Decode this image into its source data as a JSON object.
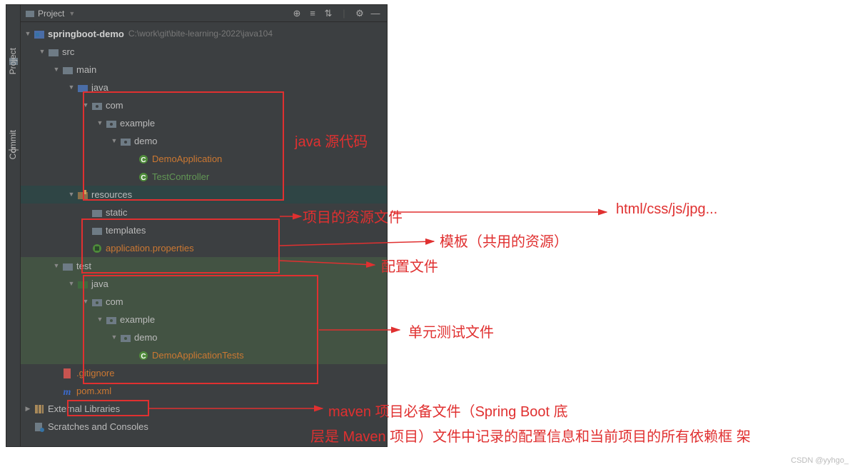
{
  "panel": {
    "title": "Project",
    "toolbar": {
      "target_icon": "⊕",
      "expand_icon": "≡",
      "options_icon": "⇅",
      "divider": "|",
      "gear_icon": "⚙",
      "hide_icon": "—"
    }
  },
  "sidebar": {
    "project_label": "Project",
    "commit_label": "Commit"
  },
  "root": {
    "name": "springboot-demo",
    "path": "C:\\work\\git\\bite-learning-2022\\java104"
  },
  "tree": {
    "src": "src",
    "main": "main",
    "java": "java",
    "com": "com",
    "example": "example",
    "demo": "demo",
    "demo_app": "DemoApplication",
    "test_ctrl": "TestController",
    "resources": "resources",
    "static": "static",
    "templates": "templates",
    "app_props": "application.properties",
    "test": "test",
    "demo_app_tests": "DemoApplicationTests",
    "gitignore": ".gitignore",
    "pom": "pom.xml",
    "ext_lib": "External Libraries",
    "scratches": "Scratches and Consoles"
  },
  "annotations": {
    "java_src": "java 源代码",
    "res_files": "项目的资源文件",
    "html_etc": "html/css/js/jpg...",
    "template": "模板（共用的资源）",
    "config": "配置文件",
    "unit_test": "单元测试文件",
    "maven1": "maven 项目必备文件（Spring Boot 底",
    "maven2": "层是 Maven 项目）文件中记录的配置信息和当前项目的所有依赖框  架"
  },
  "watermark": "CSDN @yyhgo_"
}
